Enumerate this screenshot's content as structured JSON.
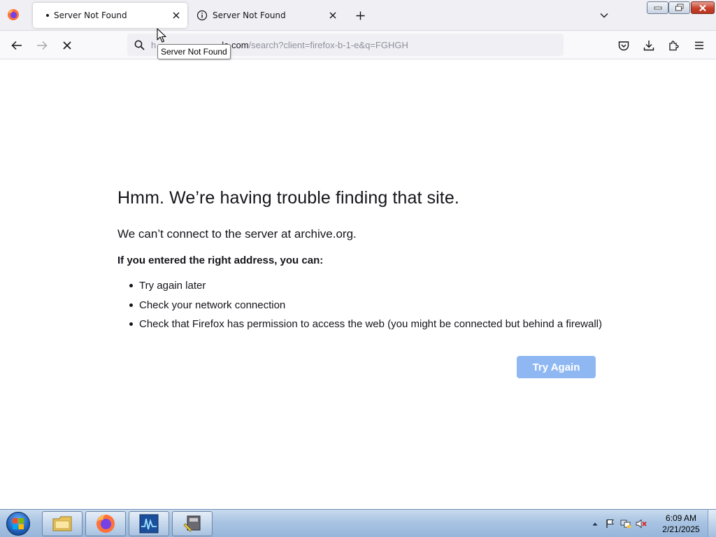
{
  "browser": {
    "tabs": [
      {
        "title": "Server Not Found",
        "active": true
      },
      {
        "title": "Server Not Found",
        "active": false
      }
    ],
    "url": {
      "prefix": "h",
      "host": "le.com",
      "path": "/search?client=firefox-b-1-e&q=FGHGH"
    },
    "tooltip": "Server Not Found"
  },
  "error": {
    "title": "Hmm. We’re having trouble finding that site.",
    "description": "We can’t connect to the server at archive.org.",
    "help_heading": "If you entered the right address, you can:",
    "suggestions": [
      "Try again later",
      "Check your network connection",
      "Check that Firefox has permission to access the web (you might be connected but behind a firewall)"
    ],
    "button_label": "Try Again"
  },
  "taskbar": {
    "apps": [
      "file-explorer",
      "firefox",
      "activity-monitor",
      "installer"
    ],
    "clock_time": "6:09 AM",
    "clock_date": "2/21/2025"
  },
  "colors": {
    "accent_button": "#8fb8f3",
    "text": "#15141a",
    "tab_strip": "#f0f0f4"
  }
}
